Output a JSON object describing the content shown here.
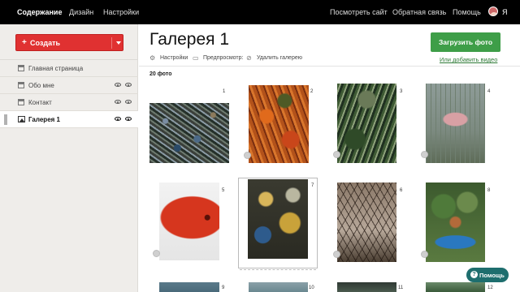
{
  "topbar": {
    "left": [
      "Содержание",
      "Дизайн",
      "Настройки"
    ],
    "right": [
      "Посмотреть сайт",
      "Обратная связь",
      "Помощь"
    ],
    "user_letter": "Я"
  },
  "sidebar": {
    "create_label": "Создать",
    "create_plus": "+",
    "items": [
      {
        "label": "Главная страница",
        "icon": "page-icon",
        "eyes": false,
        "active": false
      },
      {
        "label": "Обо мне",
        "icon": "page-icon",
        "eyes": true,
        "active": false
      },
      {
        "label": "Контакт",
        "icon": "page-icon",
        "eyes": true,
        "active": false
      },
      {
        "label": "Галерея 1",
        "icon": "gallery-icon",
        "eyes": true,
        "active": true
      }
    ]
  },
  "main": {
    "title": "Галерея 1",
    "upload_label": "Загрузить фото",
    "add_video_label": "Или добавить видео",
    "toolbar": {
      "settings": "Настройки",
      "preview": "Предпросмотр:",
      "delete": "Удалить галерею"
    },
    "photo_count": "20 фото"
  },
  "gallery": {
    "numbers": [
      "1",
      "2",
      "3",
      "4",
      "5",
      "6",
      "7",
      "8",
      "9",
      "10",
      "11",
      "12"
    ]
  },
  "help": {
    "label": "Помощь",
    "q": "?"
  },
  "colors": {
    "accent_red": "#e03131",
    "accent_green": "#3e9e48",
    "help_teal": "#1e6e6e"
  }
}
